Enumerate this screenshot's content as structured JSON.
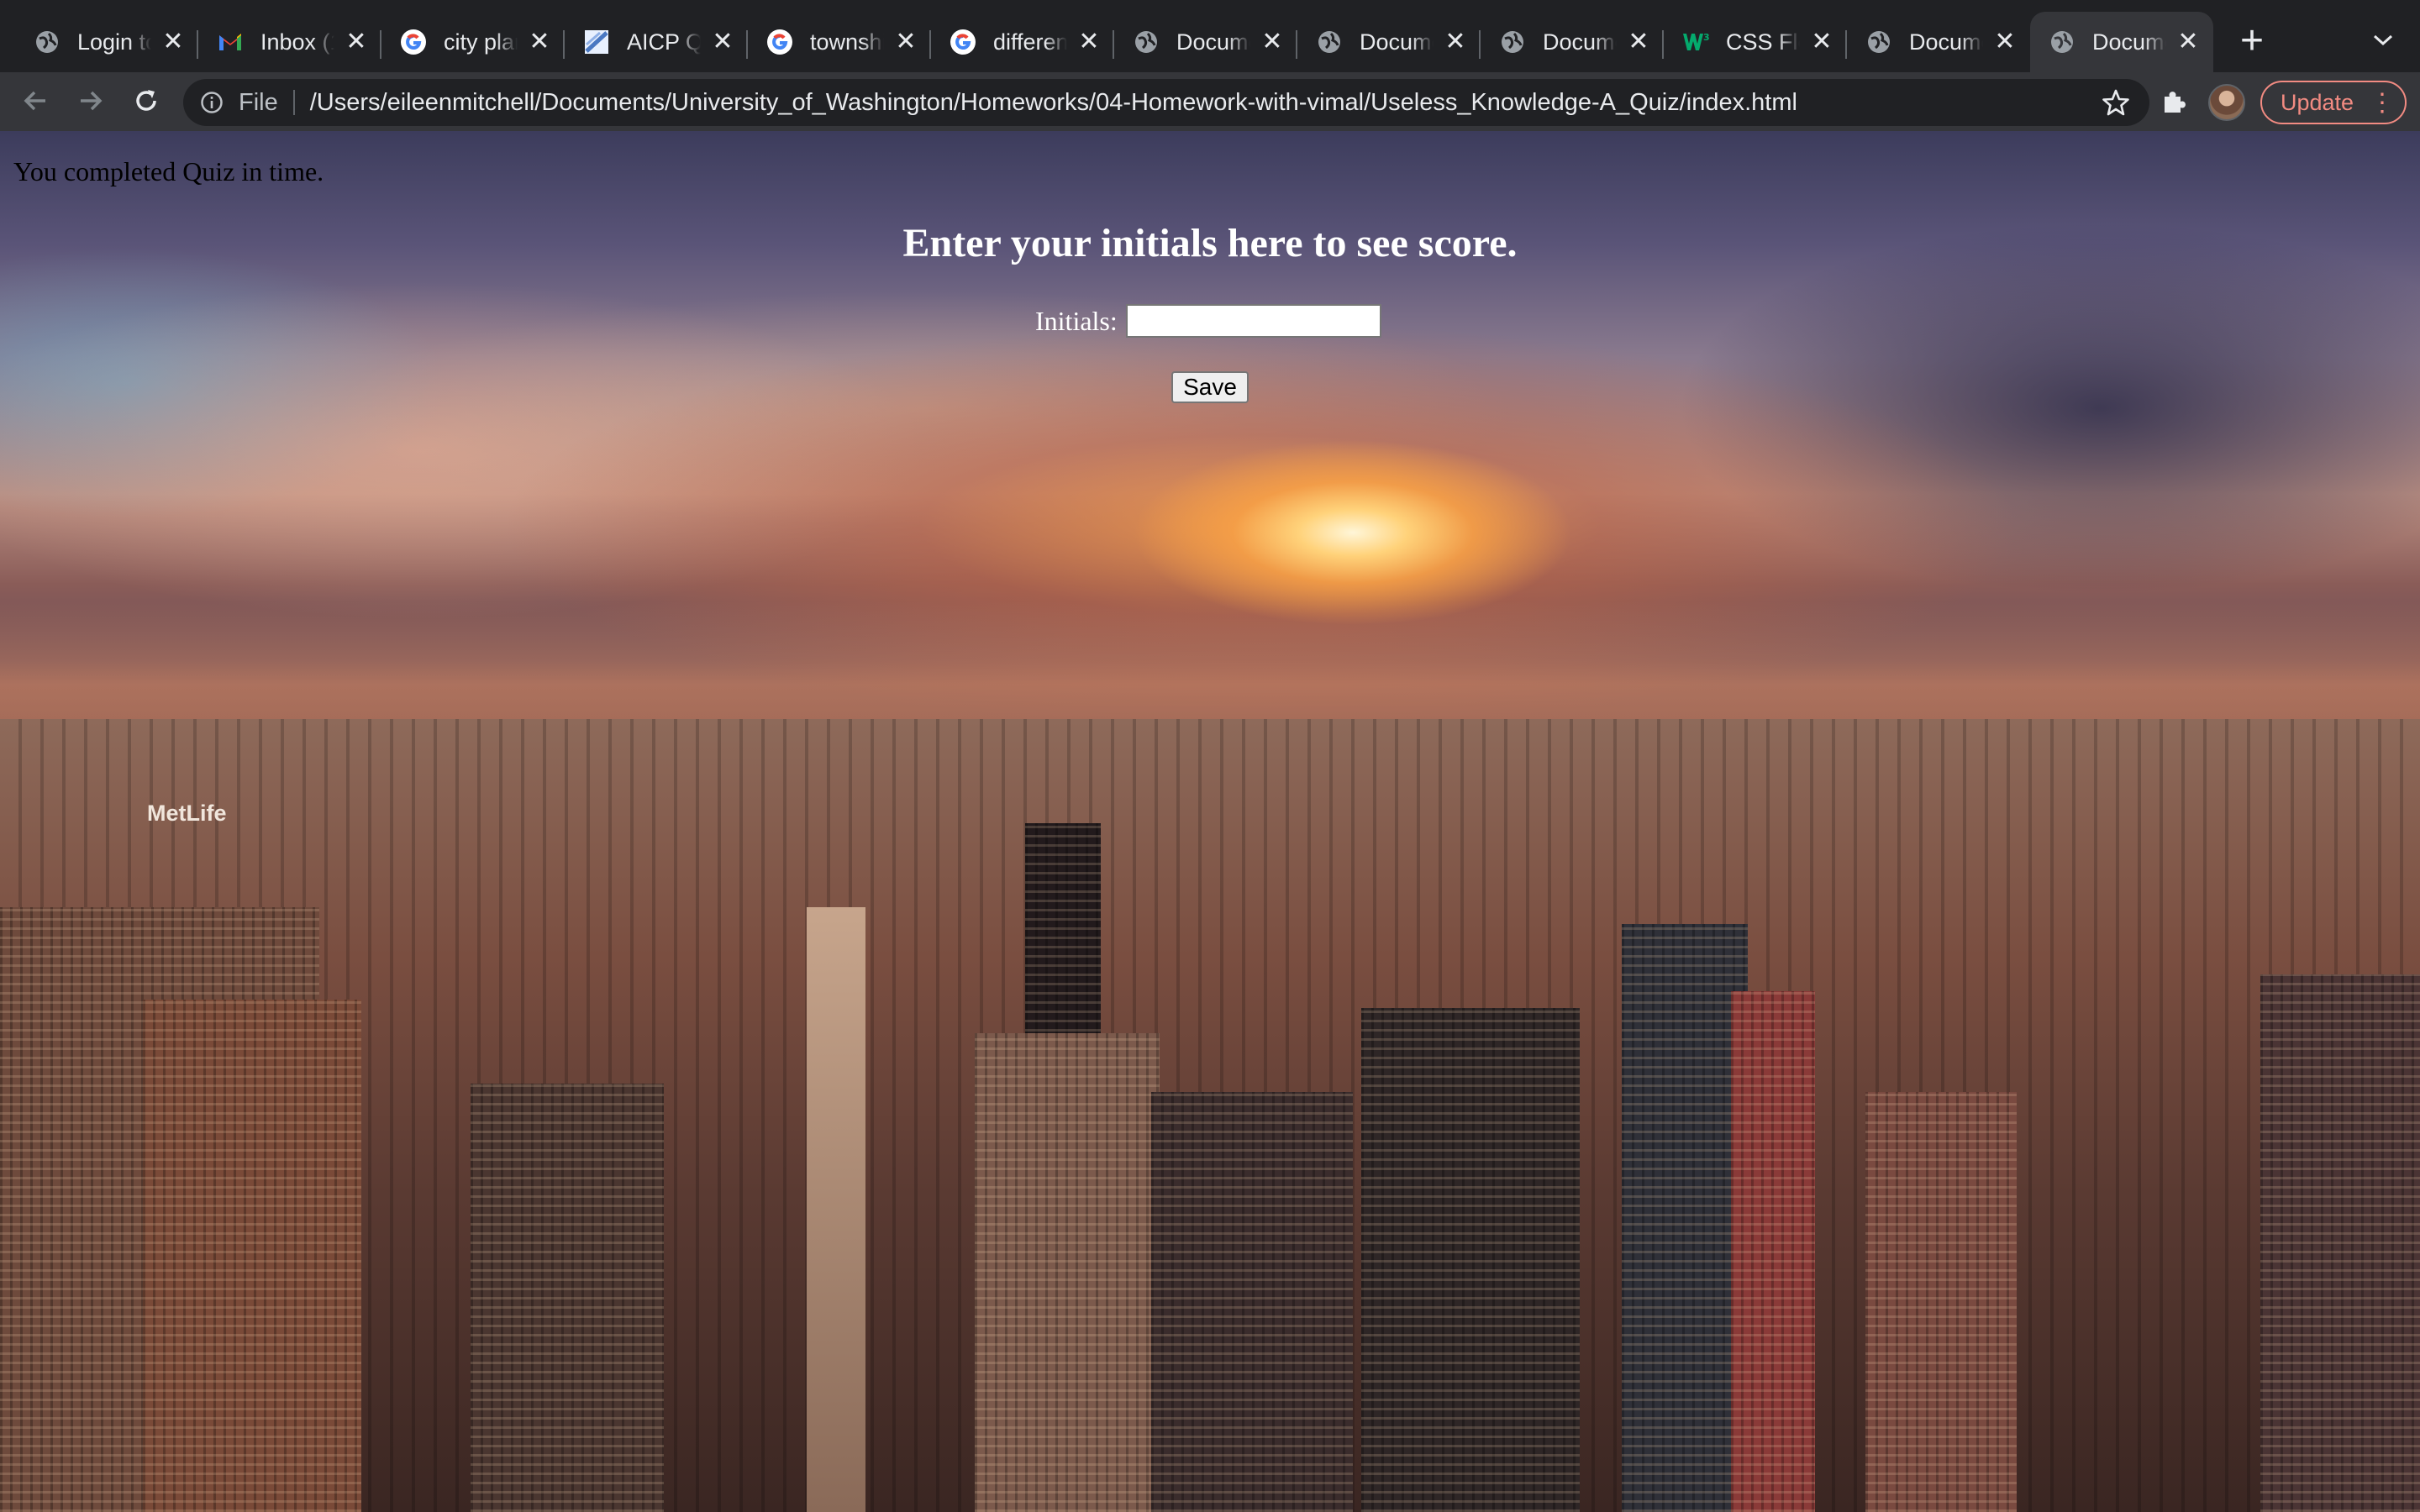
{
  "browser": {
    "tabs": [
      {
        "title": "Login to",
        "icon": "globe-icon",
        "active": false
      },
      {
        "title": "Inbox (1",
        "icon": "gmail-icon",
        "active": false
      },
      {
        "title": "city plar",
        "icon": "google-icon",
        "active": false
      },
      {
        "title": "AICP Qu",
        "icon": "site-icon",
        "active": false
      },
      {
        "title": "townshi",
        "icon": "google-icon",
        "active": false
      },
      {
        "title": "differen",
        "icon": "google-icon",
        "active": false
      },
      {
        "title": "Docume",
        "icon": "globe-icon",
        "active": false
      },
      {
        "title": "Docume",
        "icon": "globe-icon",
        "active": false
      },
      {
        "title": "Docume",
        "icon": "globe-icon",
        "active": false
      },
      {
        "title": "CSS Fle",
        "icon": "w3schools-icon",
        "active": false
      },
      {
        "title": "Docume",
        "icon": "globe-icon",
        "active": false
      },
      {
        "title": "Docume",
        "icon": "globe-icon",
        "active": true
      }
    ],
    "new_tab_label": "+",
    "address": {
      "scheme": "File",
      "url": "/Users/eileenmitchell/Documents/University_of_Washington/Homeworks/04-Homework-with-vimal/Useless_Knowledge-A_Quiz/index.html"
    },
    "update_label": "Update",
    "colors": {
      "update_accent": "#f28b82",
      "toolbar": "#35363a",
      "tabstrip": "#202124"
    }
  },
  "page": {
    "status_message": "You completed Quiz in time.",
    "heading": "Enter your initials here to see score.",
    "initials_label": "Initials:",
    "initials_value": "",
    "save_label": "Save",
    "background_sign": "MetLife"
  }
}
